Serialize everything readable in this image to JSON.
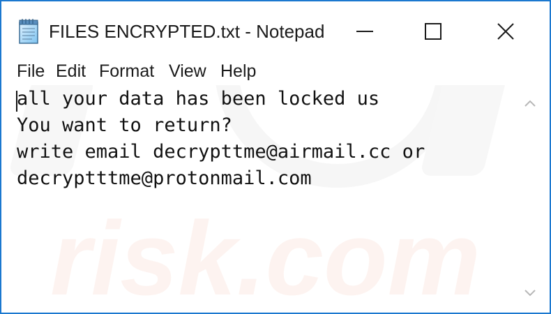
{
  "window": {
    "title": "FILES ENCRYPTED.txt - Notepad",
    "accent_color": "#1b78cf",
    "icon": "notepad-icon"
  },
  "controls": {
    "minimize_icon": "minimize-icon",
    "maximize_icon": "maximize-icon",
    "close_icon": "close-icon"
  },
  "menu": {
    "items": [
      "File",
      "Edit",
      "Format",
      "View",
      "Help"
    ]
  },
  "document": {
    "lines": [
      "all your data has been locked us",
      "You want to return?",
      "write email decrypttme@airmail.cc or",
      "decryptttme@protonmail.com"
    ]
  },
  "watermark": {
    "text": "risk.com",
    "color": "#e96a3a"
  },
  "scrollbar": {
    "up_icon": "scroll-up-arrow-icon",
    "down_icon": "scroll-down-arrow-icon"
  }
}
